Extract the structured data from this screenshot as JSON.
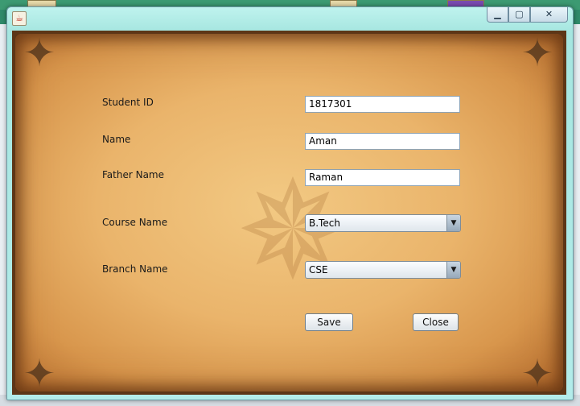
{
  "window": {
    "icon": "java-icon",
    "controls": {
      "minimize": "minimize-icon",
      "maximize": "maximize-icon",
      "close": "close-icon"
    }
  },
  "form": {
    "student_id_label": "Student ID",
    "student_id_value": "1817301",
    "name_label": "Name",
    "name_value": "Aman",
    "father_name_label": "Father Name",
    "father_name_value": "Raman",
    "course_label": "Course Name",
    "course_value": "B.Tech",
    "branch_label": "Branch Name",
    "branch_value": "CSE"
  },
  "buttons": {
    "save": "Save",
    "close": "Close"
  },
  "colors": {
    "parchment": "#eab46b",
    "frame": "#5d3617",
    "titlebar": "#bff3ee"
  }
}
